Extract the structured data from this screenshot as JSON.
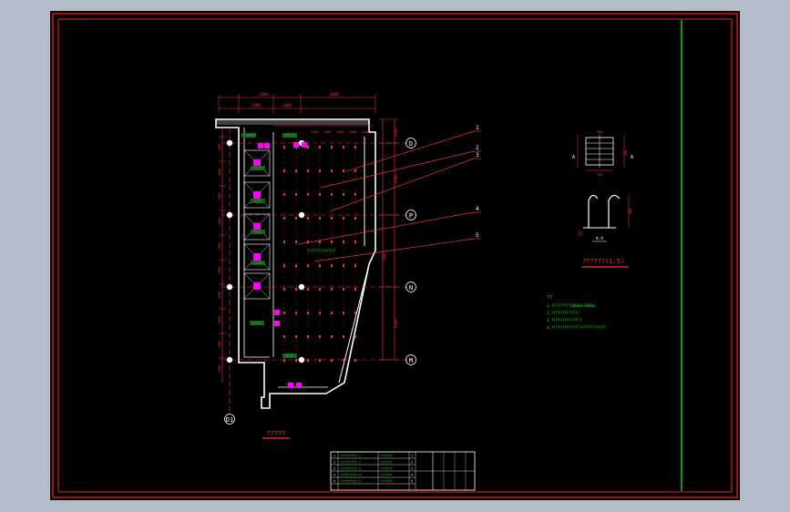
{
  "viewer": {
    "background_color": "#b3bcc8",
    "canvas_color": "#000000",
    "frame_color": "#ff2020",
    "title_strip_color": "#00e000"
  },
  "drawing": {
    "dim_color": "#ff3030",
    "text_color": "#00ff00",
    "wall_color": "#ffffff",
    "equip_color": "#ff00ff",
    "axis_labels": [
      "D",
      "P",
      "N",
      "M",
      "D1"
    ],
    "callouts": [
      "1",
      "2",
      "3",
      "4",
      "5"
    ],
    "top_dims": [
      "4600",
      "8800",
      "2400",
      "1600",
      "1500",
      "1800",
      "1800",
      "1500",
      "1200"
    ],
    "right_dims": [
      "3100",
      "6500",
      "7800",
      "5100"
    ],
    "left_dims": [
      "1800",
      "3600",
      "1800",
      "3600",
      "1800",
      "2400",
      "1800",
      "3600",
      "1800",
      "2400"
    ],
    "room_labels": [
      "??????",
      "?????",
      "????",
      "???",
      "????",
      "????",
      "????",
      "????"
    ],
    "midfloor_text": "?????????????",
    "section_marks": [
      "A",
      "A"
    ],
    "section_dims": [
      "500",
      "300",
      "300",
      "200"
    ],
    "section_caption": "A-A",
    "detail_title": "??????(1:5)",
    "plan_title": "?????",
    "notes_heading": "??",
    "notes": [
      "1.?????????200mm×300mm",
      "2.?????????????",
      "3.??????????????",
      "4.?????????????????????????"
    ],
    "title_block_rows": [
      [
        "1",
        "??????????-1",
        "???????",
        "1"
      ],
      [
        "2",
        "??????????-2",
        "???????",
        "2"
      ],
      [
        "3",
        "??????????-3",
        "???????",
        "3"
      ],
      [
        "4",
        "??????????-4",
        "???????",
        "4"
      ],
      [
        "5",
        "??????????-5",
        "???????",
        "5"
      ]
    ]
  }
}
